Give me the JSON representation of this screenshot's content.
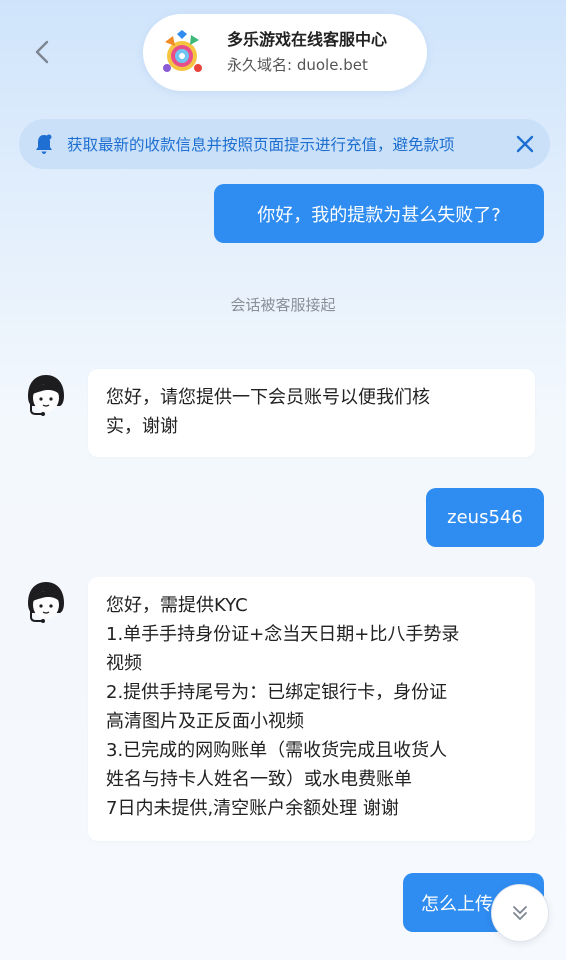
{
  "header": {
    "title": "多乐游戏在线客服中心",
    "subtitle": "永久域名: duole.bet"
  },
  "notice": {
    "text": "获取最新的收款信息并按照页面提示进行充值，避免款项"
  },
  "messages": {
    "user_1": "你好，我的提款为甚么失败了?",
    "system_1": "会话被客服接起",
    "agent_1": [
      "您好，请您提供一下会员账号以便我们核",
      "实，谢谢"
    ],
    "user_2": "zeus546",
    "agent_2": [
      "您好，需提供KYC",
      "1.单手手持身份证+念当天日期+比八手势录",
      "视频",
      "2.提供手持尾号为：已绑定银行卡，身份证",
      "高清图片及正反面小视频",
      "3.已完成的网购账单（需收货完成且收货人",
      "姓名与持卡人姓名一致）或水电费账单",
      "7日内未提供,清空账户余额处理  谢谢"
    ],
    "user_3": "怎么上传"
  },
  "colors": {
    "accent": "#2f8cf1",
    "notice_bg": "#c9e0f8",
    "notice_text": "#1e6fd1"
  },
  "icons": {
    "back": "chevron-left-icon",
    "notice": "bell-icon",
    "close": "close-icon",
    "scroll": "double-chevron-down-icon"
  }
}
